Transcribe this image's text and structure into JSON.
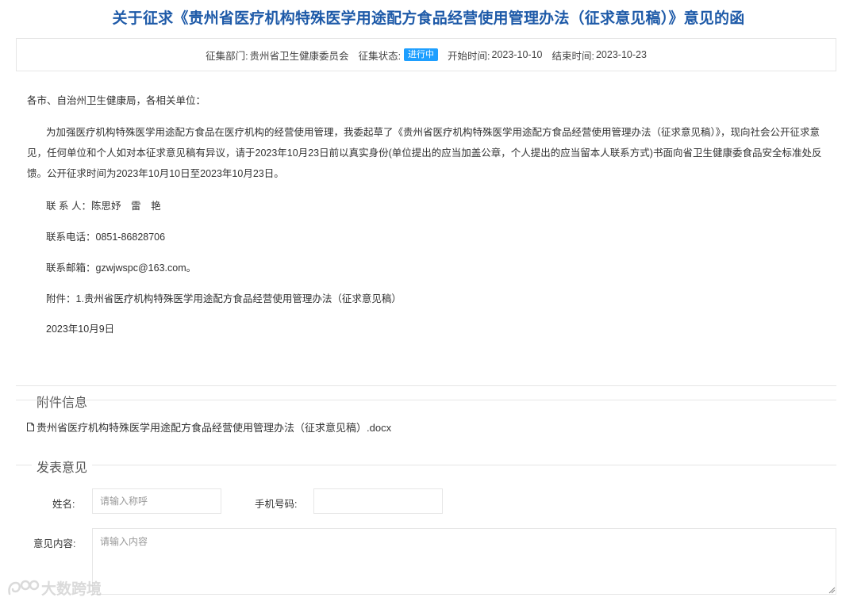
{
  "title": "关于征求《贵州省医疗机构特殊医学用途配方食品经营使用管理办法（征求意见稿）》意见的函",
  "meta": {
    "dept_label": "征集部门:",
    "dept_value": "贵州省卫生健康委员会",
    "status_label": "征集状态:",
    "status_value": "进行中",
    "start_label": "开始时间:",
    "start_value": "2023-10-10",
    "end_label": "结束时间:",
    "end_value": "2023-10-23"
  },
  "letter": {
    "greeting": "各市、自治州卫生健康局，各相关单位：",
    "paragraph": "为加强医疗机构特殊医学用途配方食品在医疗机构的经营使用管理，我委起草了《贵州省医疗机构特殊医学用途配方食品经营使用管理办法（征求意见稿）》，现向社会公开征求意见，任何单位和个人如对本征求意见稿有异议，请于2023年10月23日前以真实身份(单位提出的应当加盖公章，个人提出的应当留本人联系方式)书面向省卫生健康委食品安全标准处反馈。公开征求时间为2023年10月10日至2023年10月23日。",
    "contact": "联 系 人：陈思妤　雷　艳",
    "phone": "联系电话：0851-86828706",
    "email": "联系邮箱：gzwjwspc@163.com。",
    "attachment": "附件：1.贵州省医疗机构特殊医学用途配方食品经营使用管理办法（征求意见稿）",
    "date": "2023年10月9日"
  },
  "attachments": {
    "section_title": "附件信息",
    "files": [
      "贵州省医疗机构特殊医学用途配方食品经营使用管理办法（征求意见稿）.docx"
    ]
  },
  "opinion_form": {
    "section_title": "发表意见",
    "name_label": "姓名:",
    "name_placeholder": "请输入称呼",
    "phone_label": "手机号码:",
    "phone_placeholder": "",
    "content_label": "意见内容:",
    "content_placeholder": "请输入内容"
  },
  "watermark": {
    "text": "大数跨境"
  },
  "colors": {
    "title": "#1e5aa8",
    "badge": "#1e9fff",
    "border": "#e6e6e6"
  }
}
